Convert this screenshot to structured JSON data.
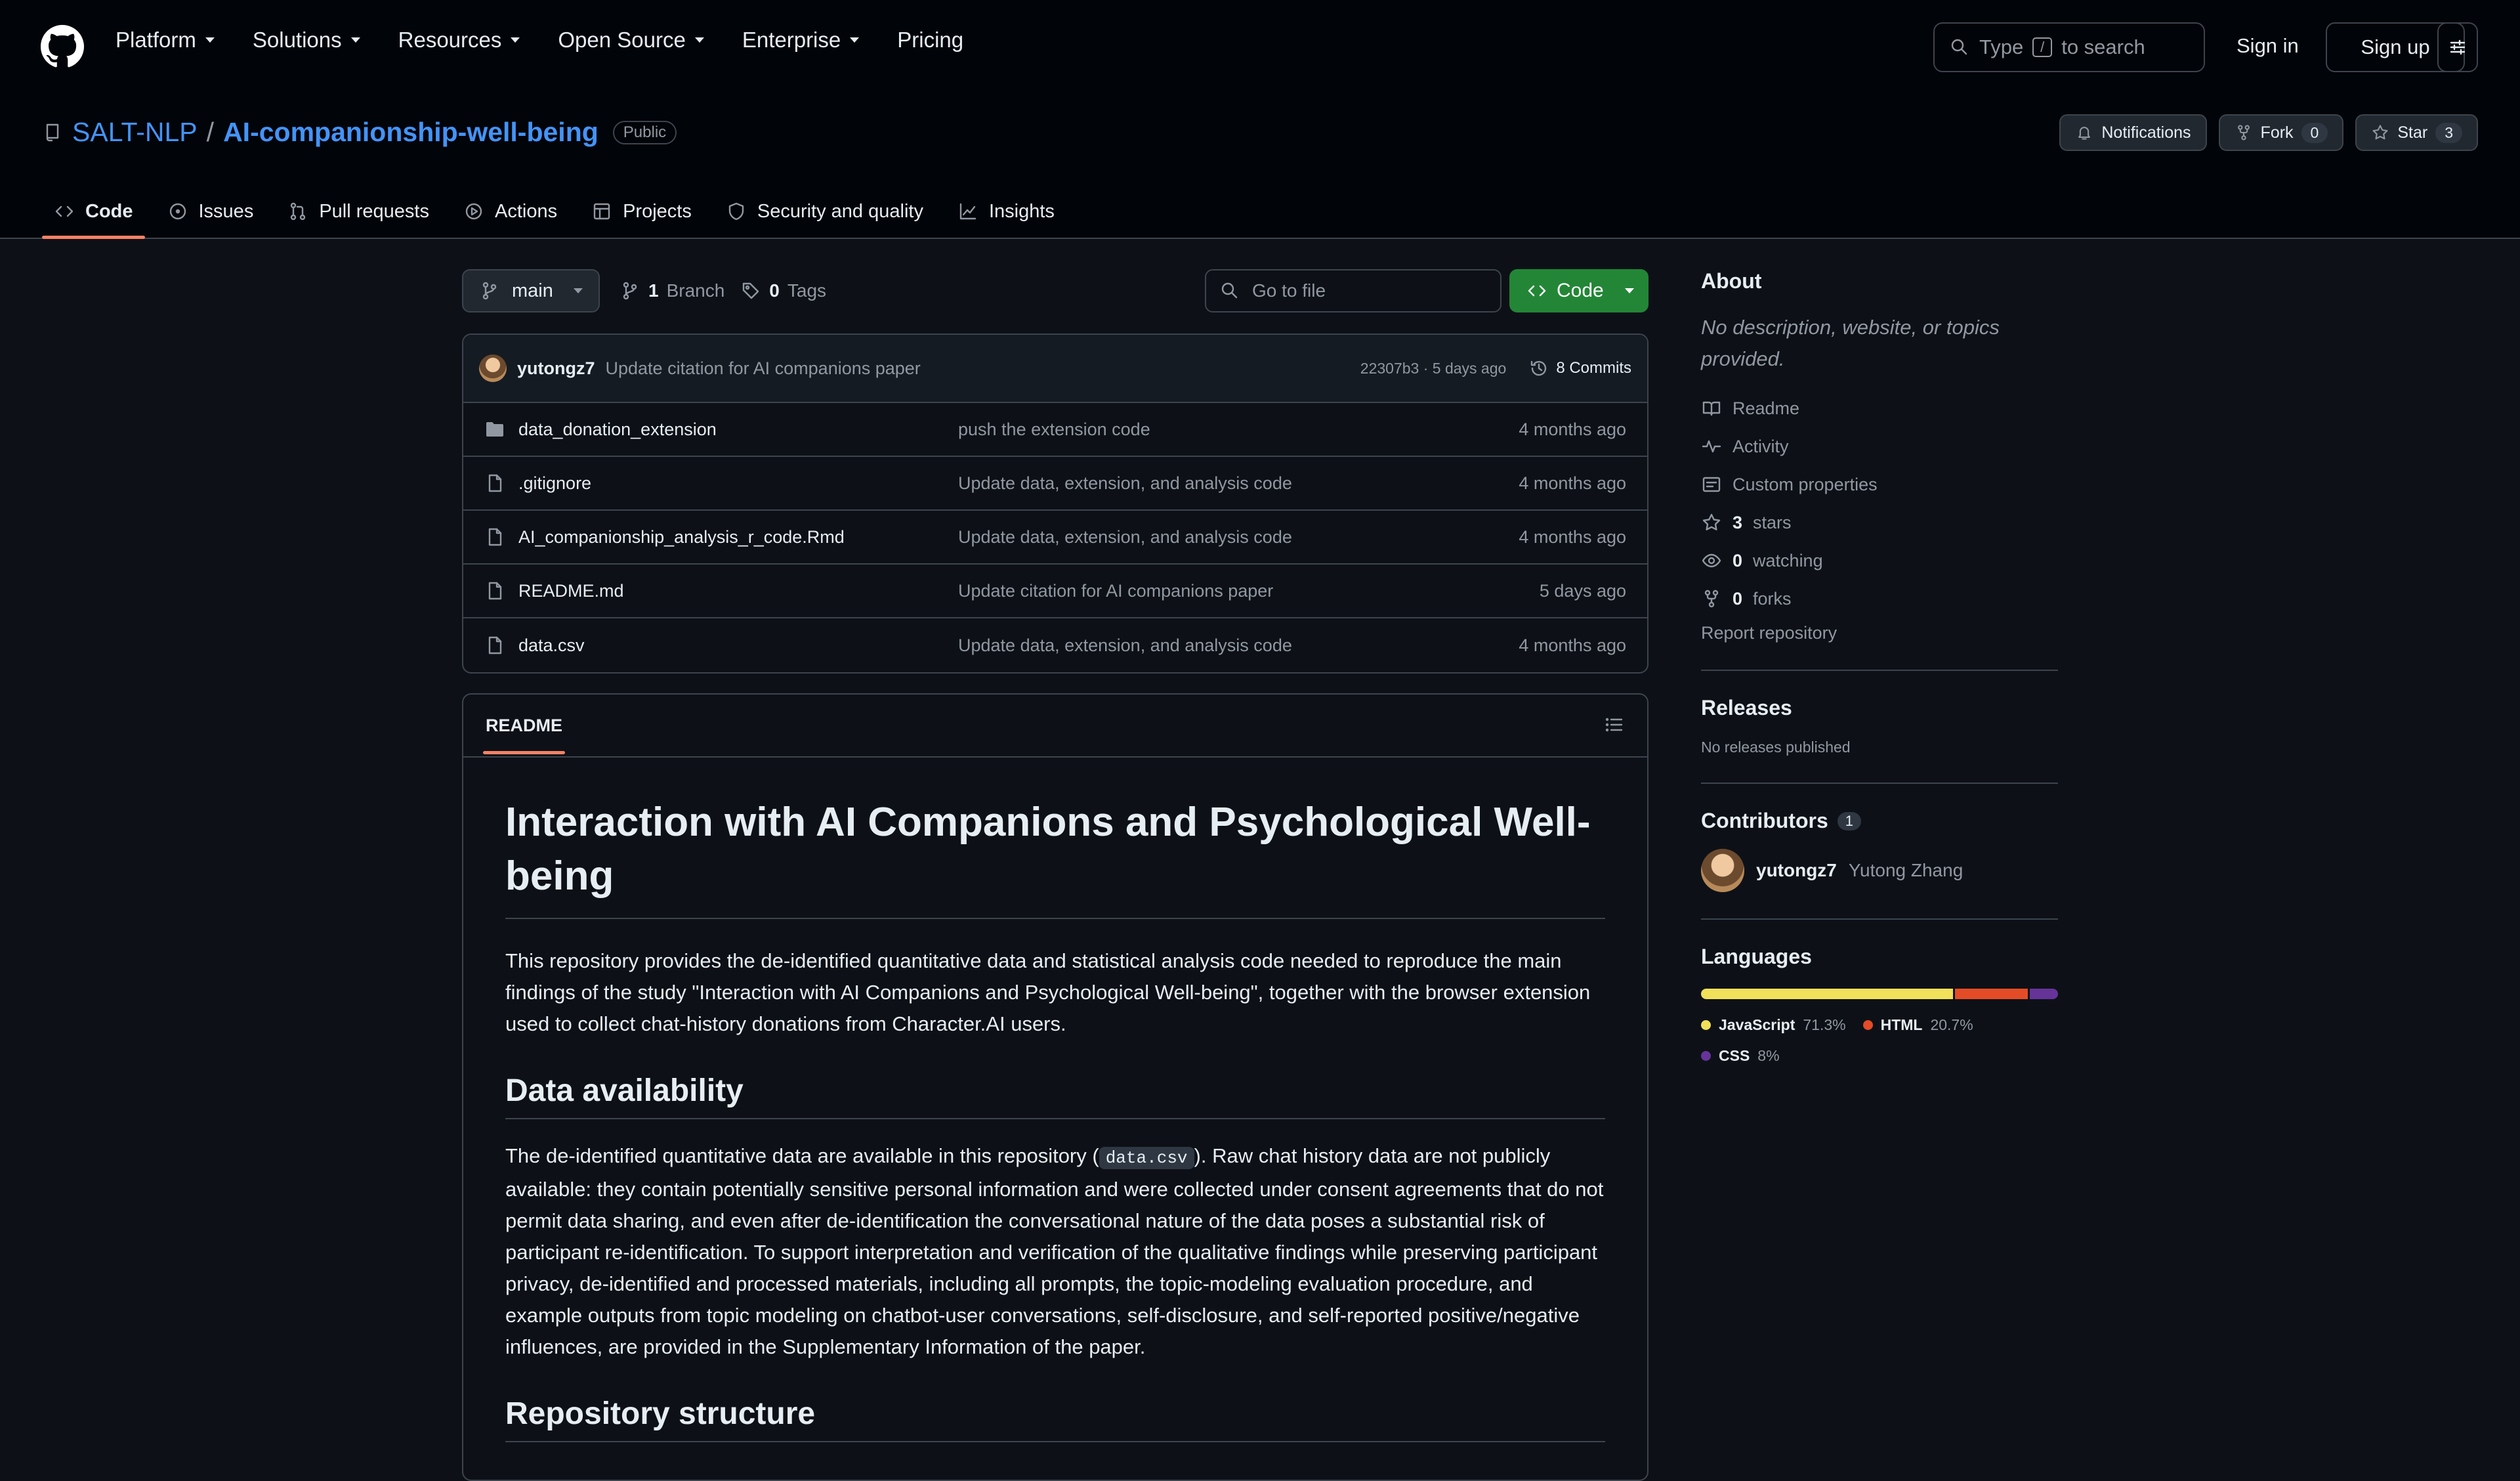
{
  "nav": {
    "items": [
      "Platform",
      "Solutions",
      "Resources",
      "Open Source",
      "Enterprise",
      "Pricing"
    ],
    "search_pre": "Type",
    "search_key": "/",
    "search_post": "to search",
    "sign_in": "Sign in",
    "sign_up": "Sign up"
  },
  "repo": {
    "owner": "SALT-NLP",
    "separator": "/",
    "name": "AI-companionship-well-being",
    "visibility": "Public",
    "notifications": "Notifications",
    "fork_label": "Fork",
    "fork_count": "0",
    "star_label": "Star",
    "star_count": "3"
  },
  "tabs": [
    "Code",
    "Issues",
    "Pull requests",
    "Actions",
    "Projects",
    "Security and quality",
    "Insights"
  ],
  "toolbar": {
    "branch": "main",
    "branch_count": "1",
    "branch_label": "Branch",
    "tag_count": "0",
    "tag_label": "Tags",
    "goto_placeholder": "Go to file",
    "code_button": "Code"
  },
  "latest_commit": {
    "author": "yutongz7",
    "message": "Update citation for AI companions paper",
    "hash_time": "22307b3 · 5 days ago",
    "commits": "8 Commits"
  },
  "files": [
    {
      "type": "folder",
      "name": "data_donation_extension",
      "message": "push the extension code",
      "age": "4 months ago"
    },
    {
      "type": "file",
      "name": ".gitignore",
      "message": "Update data, extension, and analysis code",
      "age": "4 months ago"
    },
    {
      "type": "file",
      "name": "AI_companionship_analysis_r_code.Rmd",
      "message": "Update data, extension, and analysis code",
      "age": "4 months ago"
    },
    {
      "type": "file",
      "name": "README.md",
      "message": "Update citation for AI companions paper",
      "age": "5 days ago"
    },
    {
      "type": "file",
      "name": "data.csv",
      "message": "Update data, extension, and analysis code",
      "age": "4 months ago"
    }
  ],
  "readme": {
    "tab": "README",
    "title": "Interaction with AI Companions and Psychological Well-being",
    "intro": "This repository provides the de-identified quantitative data and statistical analysis code needed to reproduce the main findings of the study \"Interaction with AI Companions and Psychological Well-being\", together with the browser extension used to collect chat-history donations from Character.AI users.",
    "h2_data": "Data availability",
    "data_pre": "The de-identified quantitative data are available in this repository (",
    "data_code": "data.csv",
    "data_post": "). Raw chat history data are not publicly available: they contain potentially sensitive personal information and were collected under consent agreements that do not permit data sharing, and even after de-identification the conversational nature of the data poses a substantial risk of participant re-identification. To support interpretation and verification of the qualitative findings while preserving participant privacy, de-identified and processed materials, including all prompts, the topic-modeling evaluation procedure, and example outputs from topic modeling on chatbot-user conversations, self-disclosure, and self-reported positive/negative influences, are provided in the Supplementary Information of the paper.",
    "h2_structure": "Repository structure"
  },
  "sidebar": {
    "about_title": "About",
    "about_desc": "No description, website, or topics provided.",
    "links": [
      {
        "icon": "book-icon",
        "label": "Readme"
      },
      {
        "icon": "pulse-icon",
        "label": "Activity"
      },
      {
        "icon": "note-icon",
        "label": "Custom properties"
      },
      {
        "icon": "star-icon",
        "count": "3",
        "label": "stars"
      },
      {
        "icon": "eye-icon",
        "count": "0",
        "label": "watching"
      },
      {
        "icon": "fork-icon",
        "count": "0",
        "label": "forks"
      }
    ],
    "report": "Report repository",
    "releases_title": "Releases",
    "releases_empty": "No releases published",
    "contributors_title": "Contributors",
    "contributors_count": "1",
    "contributor_login": "yutongz7",
    "contributor_name": "Yutong Zhang",
    "languages_title": "Languages",
    "languages": [
      {
        "name": "JavaScript",
        "pct": "71.3%",
        "value": 71.3,
        "color": "#f1e05a"
      },
      {
        "name": "HTML",
        "pct": "20.7%",
        "value": 20.7,
        "color": "#e34c26"
      },
      {
        "name": "CSS",
        "pct": "8%",
        "value": 8.0,
        "color": "#663399"
      }
    ]
  }
}
